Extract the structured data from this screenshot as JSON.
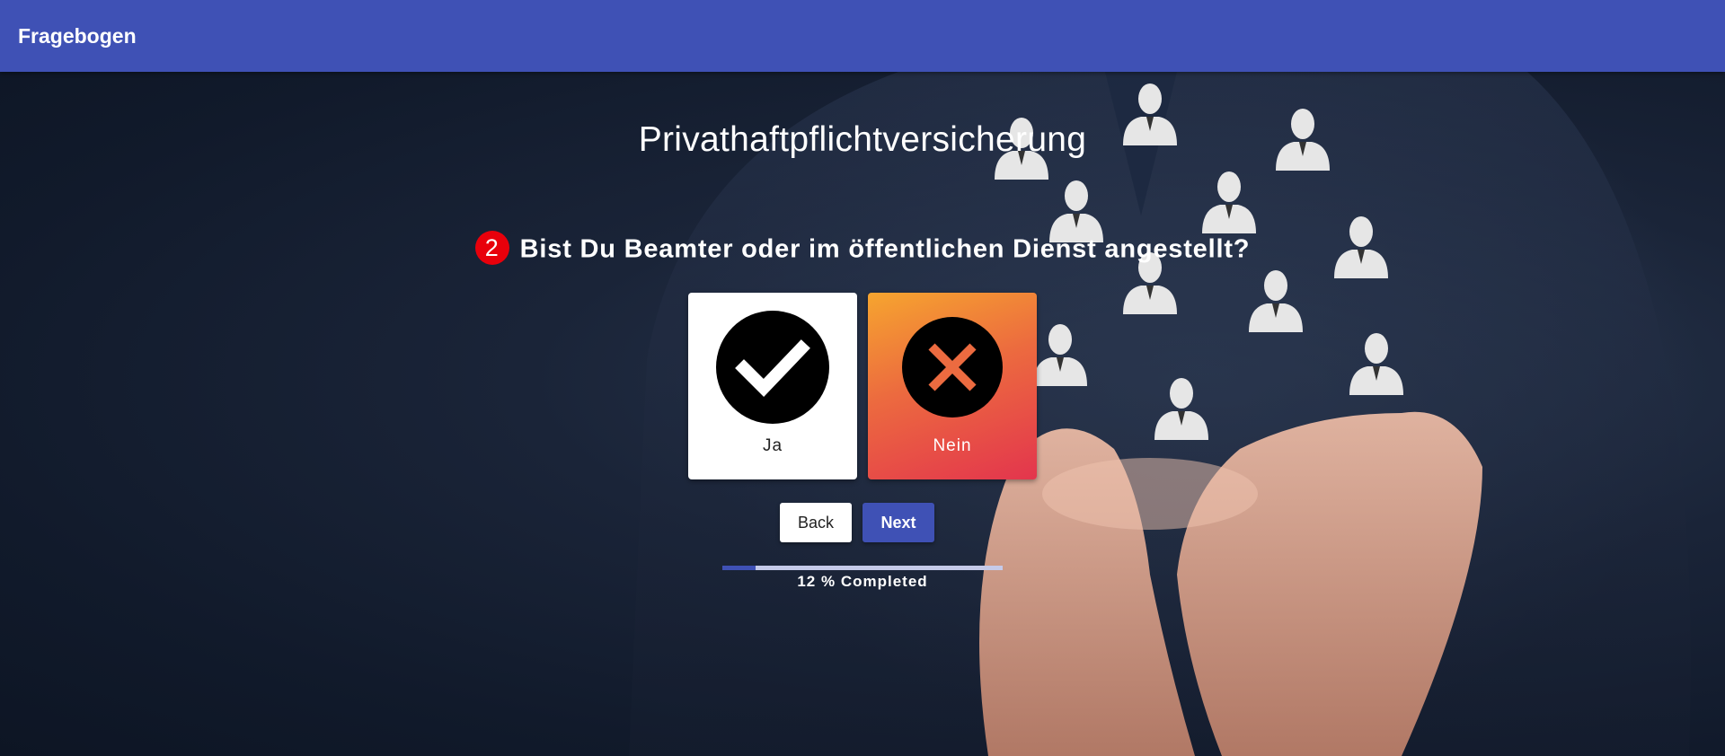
{
  "appbar": {
    "title": "Fragebogen"
  },
  "page": {
    "title": "Privathaftpflichtversicherung"
  },
  "question": {
    "number": "2",
    "text": "Bist Du Beamter oder im öffentlichen Dienst angestellt?"
  },
  "options": [
    {
      "label": "Ja",
      "icon": "check-circle-icon",
      "selected": false
    },
    {
      "label": "Nein",
      "icon": "x-circle-icon",
      "selected": true
    }
  ],
  "buttons": {
    "back": "Back",
    "next": "Next"
  },
  "progress": {
    "percent": 12,
    "label": "12 % Completed"
  },
  "colors": {
    "appbar": "#3f51b5",
    "primary": "#3f51b5",
    "question_badge": "#e8000b",
    "selected_gradient_start": "#f6a52f",
    "selected_gradient_end": "#e3354d",
    "progress_track": "#c5cae9"
  }
}
